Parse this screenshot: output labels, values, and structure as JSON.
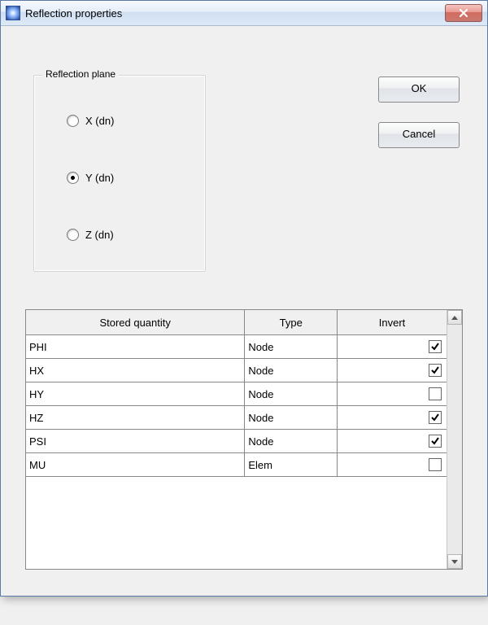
{
  "window": {
    "title": "Reflection properties"
  },
  "buttons": {
    "ok": "OK",
    "cancel": "Cancel"
  },
  "group": {
    "title": "Reflection plane",
    "options": [
      {
        "label": "X (dn)",
        "checked": false
      },
      {
        "label": "Y (dn)",
        "checked": true
      },
      {
        "label": "Z (dn)",
        "checked": false
      }
    ]
  },
  "table": {
    "headers": {
      "qty": "Stored quantity",
      "type": "Type",
      "invert": "Invert"
    },
    "rows": [
      {
        "qty": "PHI",
        "type": "Node",
        "invert": true
      },
      {
        "qty": "HX",
        "type": "Node",
        "invert": true
      },
      {
        "qty": "HY",
        "type": "Node",
        "invert": false
      },
      {
        "qty": "HZ",
        "type": "Node",
        "invert": true
      },
      {
        "qty": "PSI",
        "type": "Node",
        "invert": true
      },
      {
        "qty": "MU",
        "type": "Elem",
        "invert": false
      }
    ]
  }
}
